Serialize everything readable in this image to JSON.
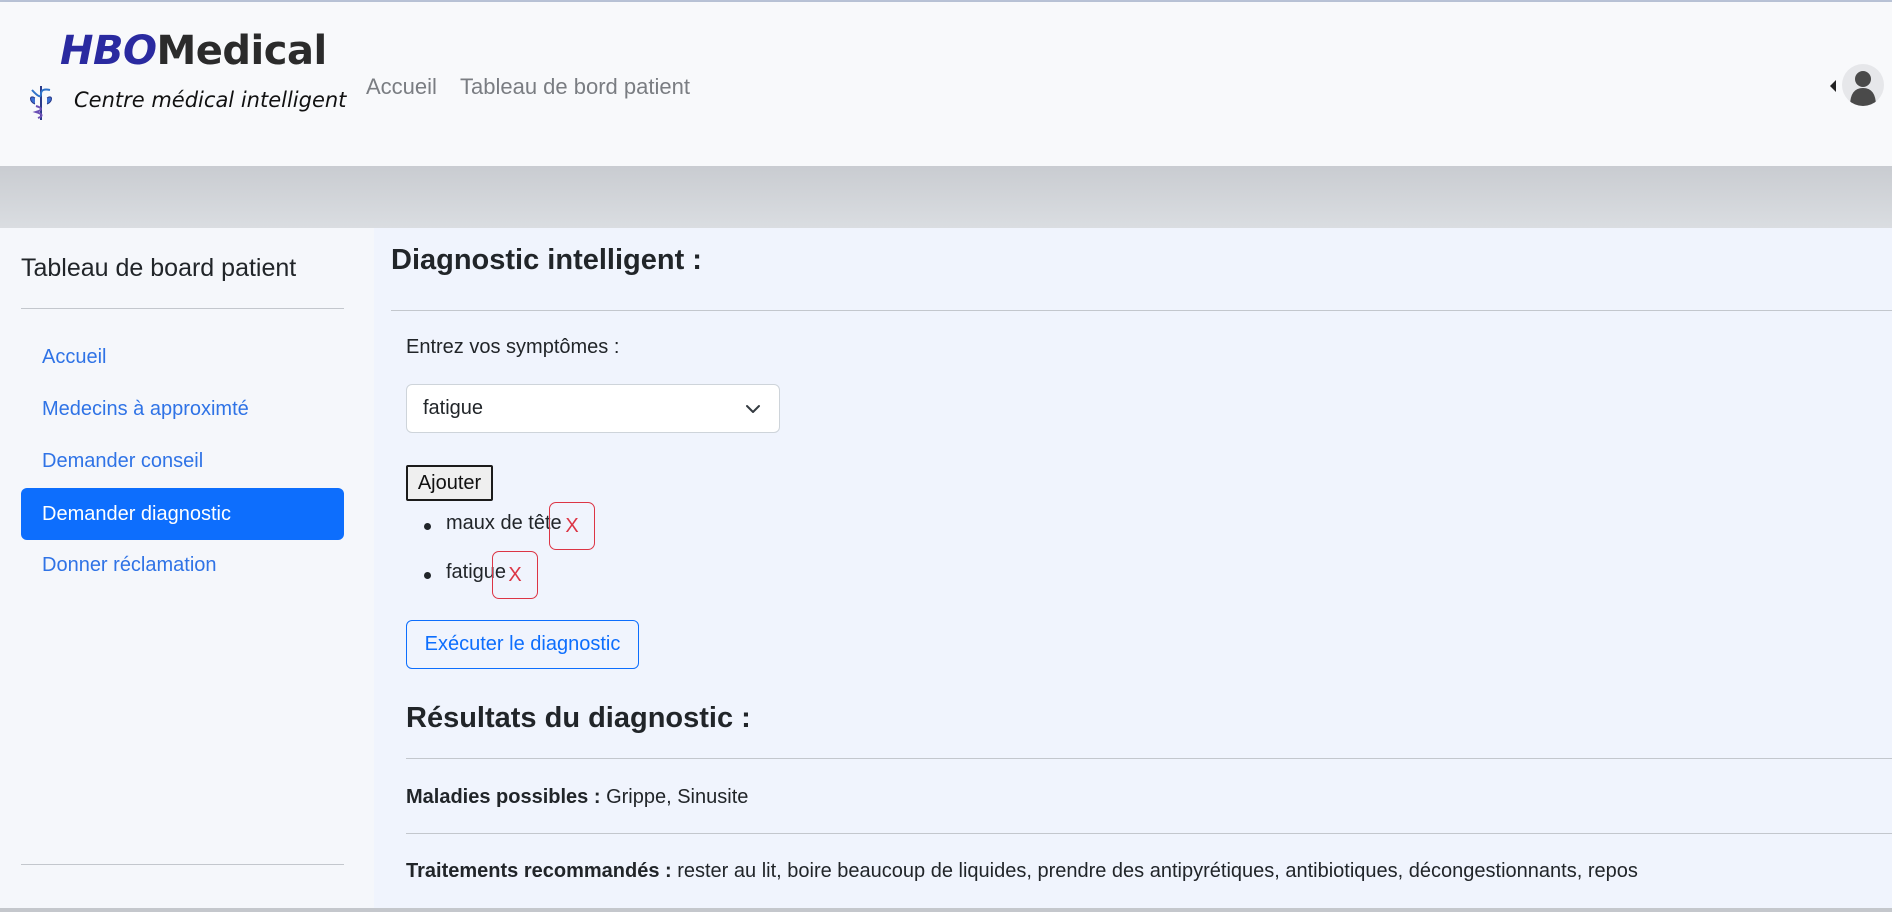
{
  "brand": {
    "name_part1": "HBO",
    "name_part2": "Medical",
    "tagline": "Centre médical intelligent",
    "colors": {
      "part1": "#2a2aa0",
      "part2": "#2b2b2b"
    }
  },
  "navbar": {
    "links": [
      {
        "label": "Accueil"
      },
      {
        "label": "Tableau de bord patient"
      }
    ],
    "user_menu_icon": "user-avatar-icon"
  },
  "sidebar": {
    "title": "Tableau de board patient",
    "items": [
      {
        "label": "Accueil",
        "active": false
      },
      {
        "label": "Medecins à approximté",
        "active": false
      },
      {
        "label": "Demander conseil",
        "active": false
      },
      {
        "label": "Demander diagnostic",
        "active": true
      },
      {
        "label": "Donner réclamation",
        "active": false
      }
    ],
    "accent_color": "#0d6efd"
  },
  "main": {
    "title": "Diagnostic intelligent :",
    "symptom_label": "Entrez vos symptômes :",
    "symptom_select_value": "fatigue",
    "add_label": "Ajouter",
    "symptoms": [
      {
        "name": "maux de tête",
        "remove_label": "X"
      },
      {
        "name": "fatigue",
        "remove_label": "X"
      }
    ],
    "run_label": "Exécuter le diagnostic",
    "results": {
      "title": "Résultats du diagnostic :",
      "diseases_label": "Maladies possibles :",
      "diseases_value": "Grippe, Sinusite",
      "treatments_label": "Traitements recommandés :",
      "treatments_value": "rester au lit, boire beaucoup de liquides, prendre des antipyrétiques, antibiotiques, décongestionnants, repos"
    }
  }
}
